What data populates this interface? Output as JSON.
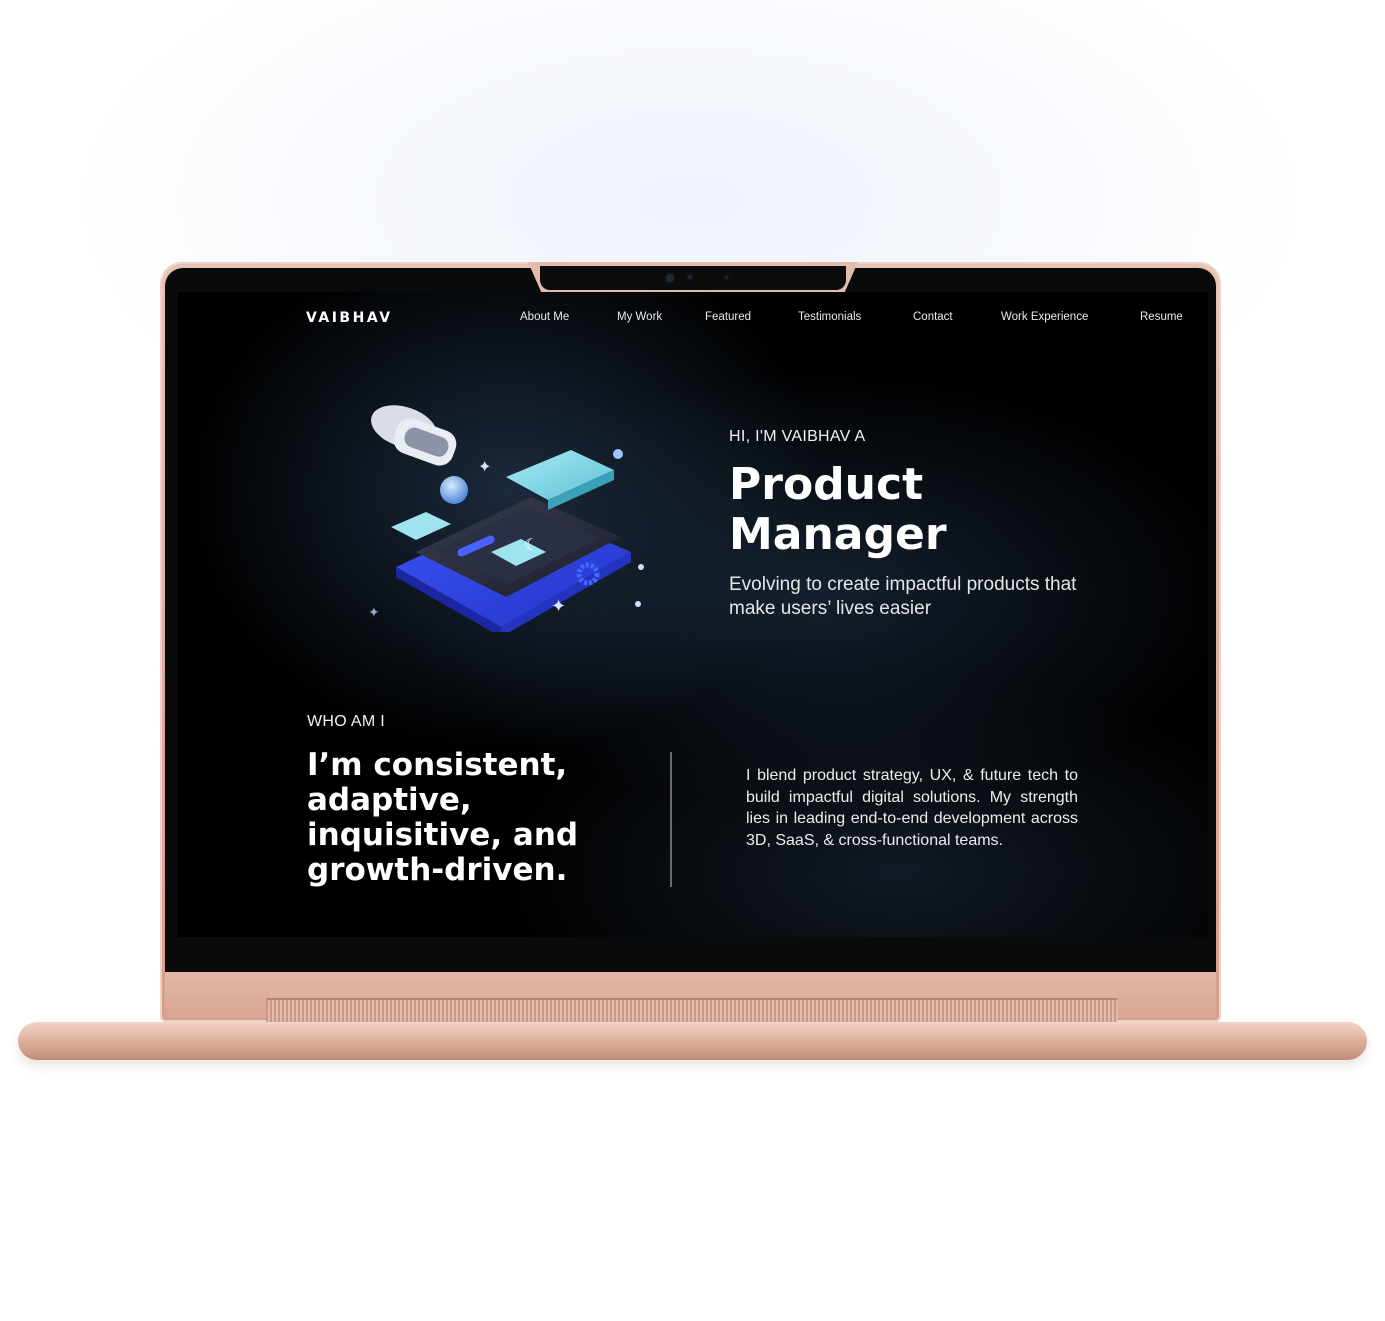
{
  "site": {
    "brand": "VAIBHAV",
    "nav": [
      "About Me",
      "My Work",
      "Featured",
      "Testimonials",
      "Contact",
      "Work Experience",
      "Resume"
    ]
  },
  "hero": {
    "eyebrow": "HI, I'M VAIBHAV A",
    "title_line1": "Product",
    "title_line2": "Manager",
    "subtitle": "Evolving to create impactful products that make users’ lives easier",
    "illustration_icon": "isometric-phone-vr-illustration"
  },
  "about": {
    "eyebrow": "WHO AM I",
    "title": "I’m consistent, adaptive, inquisitive, and growth-driven.",
    "body": "I blend product strategy, UX, & future tech to build impactful digital solutions. My strength lies in leading end-to-end development across 3D, SaaS, & cross-functional teams."
  },
  "colors": {
    "laptop_body": "#dcab98",
    "screen_bg": "#000000",
    "accent_blue": "#4a5cf0",
    "accent_cyan": "#7fd6e6"
  }
}
